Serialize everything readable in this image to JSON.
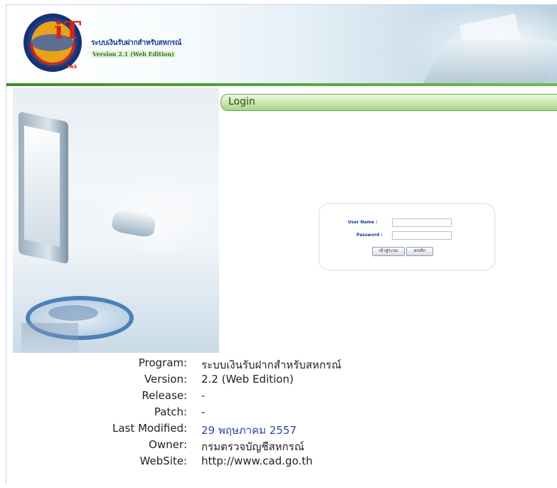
{
  "header": {
    "system_title_th": "ระบบเงินรับฝากสำหรับสหกรณ์",
    "version_label": "Version 2.1 (Web Edition)",
    "logo_text": "iT",
    "logo_ring_text": "FAS"
  },
  "login": {
    "tab_title": "Login",
    "username_label": "User Name :",
    "password_label": "Password :",
    "username_value": "",
    "password_value": "",
    "login_button": "เข้าสู่ระบบ",
    "cancel_button": "ยกเลิก"
  },
  "info": {
    "rows": [
      {
        "label": "Program",
        "value": "ระบบเงินรับฝากสำหรับสหกรณ์"
      },
      {
        "label": "Version",
        "value": "2.2 (Web Edition)"
      },
      {
        "label": "Release",
        "value": "-"
      },
      {
        "label": "Patch",
        "value": "-"
      },
      {
        "label": "Last Modified",
        "value": "29 พฤษภาคม 2557"
      },
      {
        "label": "Owner",
        "value": "กรมตรวจบัญชีสหกรณ์"
      },
      {
        "label": "WebSite",
        "value": "http://www.cad.go.th"
      }
    ],
    "colon": ":"
  },
  "colors": {
    "accent_green": "#6cbf4a",
    "title_blue": "#1a3d8f",
    "date_blue": "#2b4aa0"
  }
}
